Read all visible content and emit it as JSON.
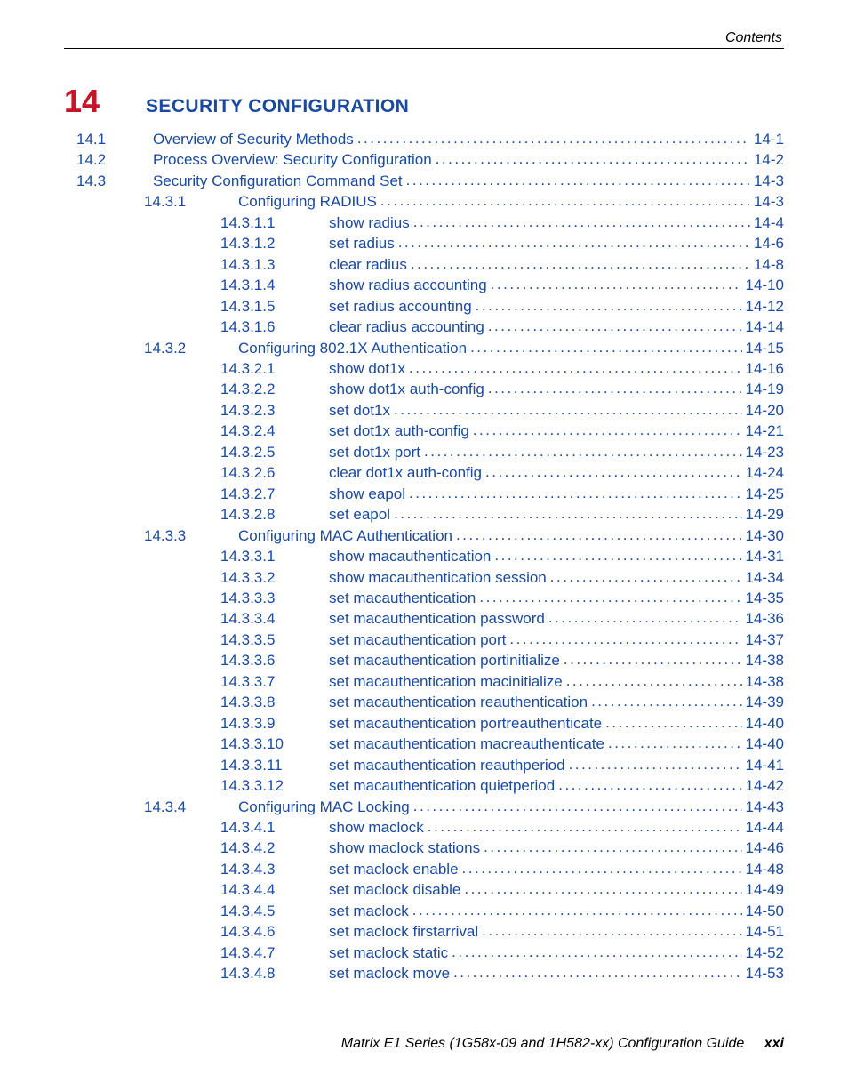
{
  "header": {
    "label": "Contents"
  },
  "chapter": {
    "number": "14",
    "title": "SECURITY CONFIGURATION"
  },
  "toc": [
    {
      "lvl": "section",
      "num": "14.1",
      "title": "Overview of Security Methods",
      "page": "14-1"
    },
    {
      "lvl": "section",
      "num": "14.2",
      "title": "Process Overview: Security Configuration",
      "page": "14-2"
    },
    {
      "lvl": "section",
      "num": "14.3",
      "title": "Security Configuration Command Set",
      "page": "14-3"
    },
    {
      "lvl": "sub",
      "num": "14.3.1",
      "title": "Configuring RADIUS",
      "page": "14-3"
    },
    {
      "lvl": "leaf",
      "num": "14.3.1.1",
      "title": "show radius",
      "page": "14-4"
    },
    {
      "lvl": "leaf",
      "num": "14.3.1.2",
      "title": "set radius",
      "page": "14-6"
    },
    {
      "lvl": "leaf",
      "num": "14.3.1.3",
      "title": "clear radius",
      "page": "14-8"
    },
    {
      "lvl": "leaf",
      "num": "14.3.1.4",
      "title": "show radius accounting",
      "page": "14-10"
    },
    {
      "lvl": "leaf",
      "num": "14.3.1.5",
      "title": "set radius accounting",
      "page": "14-12"
    },
    {
      "lvl": "leaf",
      "num": "14.3.1.6",
      "title": "clear radius accounting",
      "page": "14-14"
    },
    {
      "lvl": "sub",
      "num": "14.3.2",
      "title": "Configuring 802.1X Authentication",
      "page": "14-15"
    },
    {
      "lvl": "leaf",
      "num": "14.3.2.1",
      "title": "show dot1x",
      "page": "14-16"
    },
    {
      "lvl": "leaf",
      "num": "14.3.2.2",
      "title": "show dot1x auth-config",
      "page": "14-19"
    },
    {
      "lvl": "leaf",
      "num": "14.3.2.3",
      "title": "set dot1x",
      "page": "14-20"
    },
    {
      "lvl": "leaf",
      "num": "14.3.2.4",
      "title": "set dot1x auth-config",
      "page": "14-21"
    },
    {
      "lvl": "leaf",
      "num": "14.3.2.5",
      "title": "set dot1x port",
      "page": "14-23"
    },
    {
      "lvl": "leaf",
      "num": "14.3.2.6",
      "title": "clear dot1x auth-config",
      "page": "14-24"
    },
    {
      "lvl": "leaf",
      "num": "14.3.2.7",
      "title": "show eapol",
      "page": "14-25"
    },
    {
      "lvl": "leaf",
      "num": "14.3.2.8",
      "title": "set eapol",
      "page": "14-29"
    },
    {
      "lvl": "sub",
      "num": "14.3.3",
      "title": "Configuring MAC Authentication",
      "page": "14-30"
    },
    {
      "lvl": "leaf",
      "num": "14.3.3.1",
      "title": "show macauthentication",
      "page": "14-31"
    },
    {
      "lvl": "leaf",
      "num": "14.3.3.2",
      "title": "show macauthentication session",
      "page": "14-34"
    },
    {
      "lvl": "leaf",
      "num": "14.3.3.3",
      "title": "set macauthentication",
      "page": "14-35"
    },
    {
      "lvl": "leaf",
      "num": "14.3.3.4",
      "title": "set macauthentication password",
      "page": "14-36"
    },
    {
      "lvl": "leaf",
      "num": "14.3.3.5",
      "title": "set macauthentication port",
      "page": "14-37"
    },
    {
      "lvl": "leaf",
      "num": "14.3.3.6",
      "title": "set macauthentication portinitialize",
      "page": "14-38"
    },
    {
      "lvl": "leaf",
      "num": "14.3.3.7",
      "title": "set macauthentication macinitialize",
      "page": "14-38"
    },
    {
      "lvl": "leaf",
      "num": "14.3.3.8",
      "title": "set macauthentication reauthentication",
      "page": "14-39"
    },
    {
      "lvl": "leaf",
      "num": "14.3.3.9",
      "title": "set macauthentication portreauthenticate",
      "page": "14-40"
    },
    {
      "lvl": "leaf",
      "num": "14.3.3.10",
      "title": "set macauthentication macreauthenticate",
      "page": "14-40"
    },
    {
      "lvl": "leaf",
      "num": "14.3.3.11",
      "title": "set macauthentication reauthperiod",
      "page": "14-41"
    },
    {
      "lvl": "leaf",
      "num": "14.3.3.12",
      "title": "set macauthentication quietperiod",
      "page": "14-42"
    },
    {
      "lvl": "sub",
      "num": "14.3.4",
      "title": "Configuring MAC Locking",
      "page": "14-43"
    },
    {
      "lvl": "leaf",
      "num": "14.3.4.1",
      "title": "show maclock",
      "page": "14-44"
    },
    {
      "lvl": "leaf",
      "num": "14.3.4.2",
      "title": "show maclock stations",
      "page": "14-46"
    },
    {
      "lvl": "leaf",
      "num": "14.3.4.3",
      "title": "set maclock enable",
      "page": "14-48"
    },
    {
      "lvl": "leaf",
      "num": "14.3.4.4",
      "title": "set maclock disable",
      "page": "14-49"
    },
    {
      "lvl": "leaf",
      "num": "14.3.4.5",
      "title": "set maclock",
      "page": "14-50"
    },
    {
      "lvl": "leaf",
      "num": "14.3.4.6",
      "title": "set maclock firstarrival",
      "page": "14-51"
    },
    {
      "lvl": "leaf",
      "num": "14.3.4.7",
      "title": "set maclock static",
      "page": "14-52"
    },
    {
      "lvl": "leaf",
      "num": "14.3.4.8",
      "title": "set maclock move",
      "page": "14-53"
    }
  ],
  "footer": {
    "title": "Matrix E1 Series (1G58x-09 and 1H582-xx) Configuration Guide",
    "page": "xxi"
  }
}
